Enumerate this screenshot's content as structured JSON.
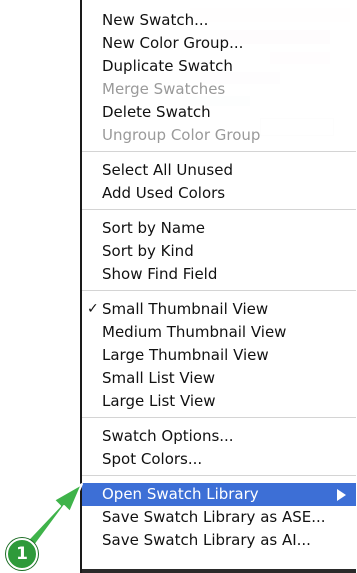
{
  "menu": {
    "groups": [
      [
        {
          "label": "New Swatch...",
          "enabled": true
        },
        {
          "label": "New Color Group...",
          "enabled": true
        },
        {
          "label": "Duplicate Swatch",
          "enabled": true
        },
        {
          "label": "Merge Swatches",
          "enabled": false
        },
        {
          "label": "Delete Swatch",
          "enabled": true
        },
        {
          "label": "Ungroup Color Group",
          "enabled": false
        }
      ],
      [
        {
          "label": "Select All Unused",
          "enabled": true
        },
        {
          "label": "Add Used Colors",
          "enabled": true
        }
      ],
      [
        {
          "label": "Sort by Name",
          "enabled": true
        },
        {
          "label": "Sort by Kind",
          "enabled": true
        },
        {
          "label": "Show Find Field",
          "enabled": true
        }
      ],
      [
        {
          "label": "Small Thumbnail View",
          "enabled": true,
          "checked": true
        },
        {
          "label": "Medium Thumbnail View",
          "enabled": true
        },
        {
          "label": "Large Thumbnail View",
          "enabled": true
        },
        {
          "label": "Small List View",
          "enabled": true
        },
        {
          "label": "Large List View",
          "enabled": true
        }
      ],
      [
        {
          "label": "Swatch Options...",
          "enabled": true
        },
        {
          "label": "Spot Colors...",
          "enabled": true
        }
      ],
      [
        {
          "label": "Open Swatch Library",
          "enabled": true,
          "highlighted": true,
          "submenu": true
        },
        {
          "label": "Save Swatch Library as ASE...",
          "enabled": true
        },
        {
          "label": "Save Swatch Library as AI...",
          "enabled": true
        }
      ]
    ]
  },
  "callout": {
    "number": "1",
    "color": "#2e9a3a"
  },
  "colors": {
    "highlight": "#3d6fd6",
    "disabled": "#9a9a9a"
  }
}
